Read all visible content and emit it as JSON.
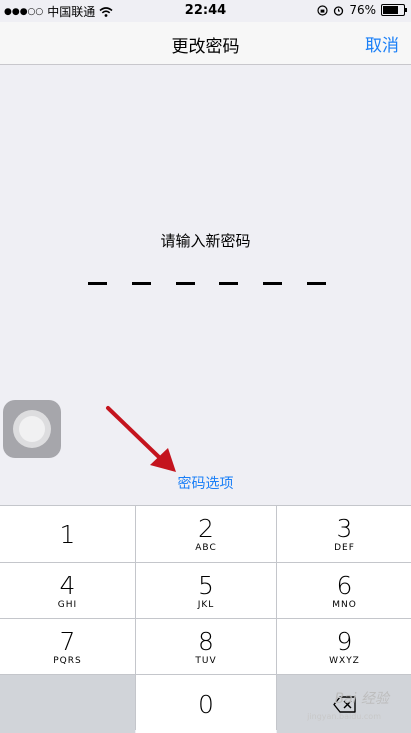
{
  "status_bar": {
    "signal_dots": "●●●○○",
    "carrier": "中国联通",
    "time": "22:44",
    "battery_percent": "76%",
    "battery_level": 0.76
  },
  "nav": {
    "title": "更改密码",
    "cancel_label": "取消"
  },
  "main": {
    "prompt": "请输入新密码",
    "options_label": "密码选项"
  },
  "keypad": {
    "keys": [
      {
        "num": "1",
        "letters": ""
      },
      {
        "num": "2",
        "letters": "ABC"
      },
      {
        "num": "3",
        "letters": "DEF"
      },
      {
        "num": "4",
        "letters": "GHI"
      },
      {
        "num": "5",
        "letters": "JKL"
      },
      {
        "num": "6",
        "letters": "MNO"
      },
      {
        "num": "7",
        "letters": "PQRS"
      },
      {
        "num": "8",
        "letters": "TUV"
      },
      {
        "num": "9",
        "letters": "WXYZ"
      },
      {
        "num": "0",
        "letters": ""
      }
    ]
  },
  "watermark": {
    "text": "Bai 经验",
    "sub": "jingyan.baidu.com"
  },
  "colors": {
    "accent": "#1a7ff7",
    "annotation_arrow": "#c4141e"
  }
}
